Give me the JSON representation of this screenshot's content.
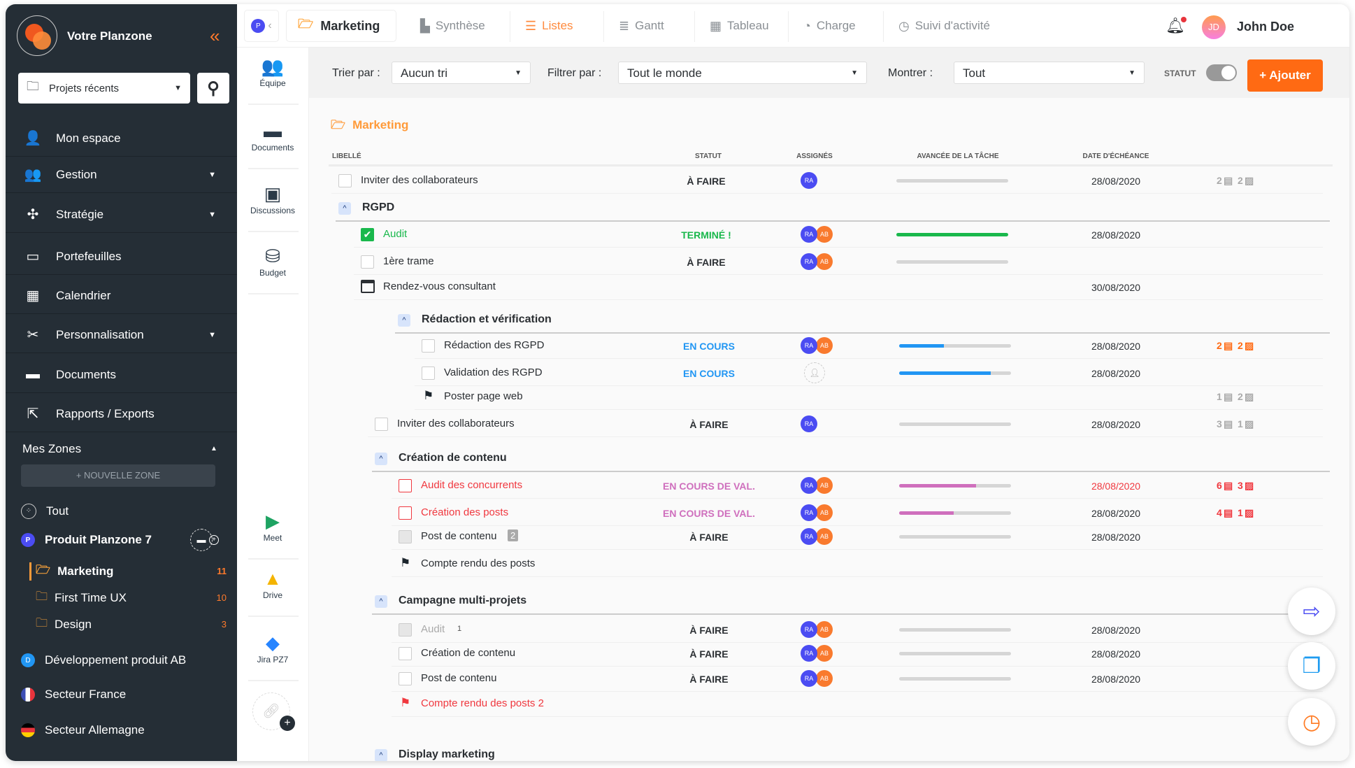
{
  "colors": {
    "accent": "#ff6a13",
    "sidebar": "#252e36",
    "ra": "#4b4cf2",
    "ab": "#f97a2e",
    "done": "#19b84c",
    "in_progress": "#2196f3",
    "validation": "#cf6fbd",
    "late": "#f0383f",
    "todo": "#2b2f33"
  },
  "sidebar": {
    "brand": "Votre Planzone",
    "recent_projects": "Projets récents",
    "menu": [
      {
        "label": "Mon espace",
        "icon": "user-lock-icon",
        "has_caret": false
      },
      {
        "label": "Gestion",
        "icon": "users-gear-icon",
        "has_caret": true
      },
      {
        "label": "Stratégie",
        "icon": "strategy-icon",
        "has_caret": true
      },
      {
        "label": "Portefeuilles",
        "icon": "wallet-icon",
        "has_caret": false
      },
      {
        "label": "Calendrier",
        "icon": "calendar-icon",
        "has_caret": false
      },
      {
        "label": "Personnalisation",
        "icon": "tools-icon",
        "has_caret": true
      },
      {
        "label": "Documents",
        "icon": "laptop-icon",
        "has_caret": false
      },
      {
        "label": "Rapports / Exports",
        "icon": "export-icon",
        "has_caret": false
      }
    ],
    "zones_title": "Mes Zones",
    "new_zone": "+ NOUVELLE ZONE",
    "all": "Tout",
    "project": {
      "badge": "P",
      "label": "Produit Planzone 7"
    },
    "folders": [
      {
        "label": "Marketing",
        "count": "11",
        "active": true
      },
      {
        "label": "First Time UX",
        "count": "10"
      },
      {
        "label": "Design",
        "count": "3"
      }
    ],
    "other_zones": [
      {
        "badge": "D",
        "label": "Développement produit AB"
      },
      {
        "label": "Secteur France",
        "icon": "flag-france-icon"
      },
      {
        "label": "Secteur Allemagne",
        "icon": "flag-germany-icon"
      }
    ]
  },
  "tools": [
    {
      "label": "Équipe",
      "icon": "team-icon"
    },
    {
      "label": "Documents",
      "icon": "laptop-icon"
    },
    {
      "label": "Discussions",
      "icon": "chat-icon"
    },
    {
      "label": "Budget",
      "icon": "coins-icon"
    },
    {
      "label": "Meet",
      "icon": "google-meet-icon"
    },
    {
      "label": "Drive",
      "icon": "google-drive-icon"
    },
    {
      "label": "Jira PZ7",
      "icon": "jira-icon"
    }
  ],
  "topbar": {
    "project_badge": "P",
    "current": "Marketing",
    "tabs": [
      {
        "label": "Synthèse",
        "icon": "dashboard-icon"
      },
      {
        "label": "Listes",
        "icon": "list-icon",
        "active": true
      },
      {
        "label": "Gantt",
        "icon": "gantt-icon"
      },
      {
        "label": "Tableau",
        "icon": "board-icon"
      },
      {
        "label": "Charge",
        "icon": "gauge-icon"
      },
      {
        "label": "Suivi d'activité",
        "icon": "clock-icon"
      }
    ],
    "user_initials": "JD",
    "user_name": "John Doe"
  },
  "filters": {
    "sort_label": "Trier par :",
    "sort_value": "Aucun tri",
    "filter_label": "Filtrer par :",
    "filter_value": "Tout le monde",
    "show_label": "Montrer :",
    "show_value": "Tout",
    "status_label": "STATUT",
    "status_toggle": false,
    "add_label": "+ Ajouter"
  },
  "list": {
    "title": "Marketing",
    "columns": [
      "LIBELLÉ",
      "STATUT",
      "ASSIGNÉS",
      "AVANCÉE DE LA TÂCHE",
      "DATE D'ÉCHÉANCE"
    ],
    "rows": [
      {
        "type": "task",
        "label": "Inviter des collaborateurs",
        "status": "À FAIRE",
        "tone": "todo",
        "assignees": [
          "RA"
        ],
        "progress": 0,
        "date": "28/08/2020",
        "comments": "2",
        "files": "2",
        "count_tone": "muted"
      },
      {
        "type": "group",
        "label": "RGPD"
      },
      {
        "type": "task",
        "label": "Audit",
        "status": "TERMINÉ !",
        "tone": "done",
        "checked": true,
        "assignees": [
          "RA",
          "AB"
        ],
        "progress": 100,
        "date": "28/08/2020"
      },
      {
        "type": "task",
        "label": "1ère trame",
        "status": "À FAIRE",
        "tone": "todo",
        "assignees": [
          "RA",
          "AB"
        ],
        "progress": 0
      },
      {
        "type": "event",
        "label": "Rendez-vous consultant",
        "date": "30/08/2020"
      },
      {
        "type": "group",
        "label": "Rédaction et vérification"
      },
      {
        "type": "task",
        "label": "Rédaction des RGPD",
        "status": "EN COURS",
        "tone": "in_progress",
        "assignees": [
          "RA",
          "AB"
        ],
        "progress": 40,
        "date": "28/08/2020",
        "comments": "2",
        "files": "2",
        "count_tone": "accent"
      },
      {
        "type": "task",
        "label": "Validation des RGPD",
        "status": "EN COURS",
        "tone": "in_progress",
        "assignees": [],
        "progress": 82,
        "date": "28/08/2020"
      },
      {
        "type": "milestone",
        "label": "Poster page web",
        "comments": "1",
        "files": "2",
        "count_tone": "muted"
      },
      {
        "type": "task",
        "label": "Inviter des collaborateurs",
        "status": "À FAIRE",
        "tone": "todo",
        "assignees": [
          "RA"
        ],
        "progress": 0,
        "date": "28/08/2020",
        "comments": "3",
        "files": "1",
        "count_tone": "muted"
      },
      {
        "type": "group",
        "label": "Création de contenu"
      },
      {
        "type": "task",
        "label": "Audit des concurrents",
        "status": "EN COURS DE VAL.",
        "tone": "validation",
        "late": true,
        "late_date": true,
        "assignees": [
          "RA",
          "AB"
        ],
        "progress": 69,
        "date": "28/08/2020",
        "comments": "6",
        "files": "3",
        "count_tone": "late"
      },
      {
        "type": "task",
        "label": "Création des posts",
        "status": "EN COURS DE VAL.",
        "tone": "validation",
        "late": true,
        "assignees": [
          "RA",
          "AB"
        ],
        "progress": 49,
        "date": "28/08/2020",
        "comments": "4",
        "files": "1",
        "count_tone": "late"
      },
      {
        "type": "task",
        "label": "Post de contenu",
        "badge": "2",
        "status": "À FAIRE",
        "tone": "todo",
        "disabled": true,
        "assignees": [
          "RA",
          "AB"
        ],
        "progress": 0,
        "date": "28/08/2020"
      },
      {
        "type": "milestone",
        "label": "Compte rendu des posts"
      },
      {
        "type": "group",
        "label": "Campagne multi-projets"
      },
      {
        "type": "task",
        "label": "Audit",
        "sub": "1",
        "status": "À FAIRE",
        "tone": "todo",
        "disabled": true,
        "faded": true,
        "assignees": [
          "RA",
          "AB"
        ],
        "progress": 0,
        "date": "28/08/2020"
      },
      {
        "type": "task",
        "label": "Création de contenu",
        "status": "À FAIRE",
        "tone": "todo",
        "assignees": [
          "RA",
          "AB"
        ],
        "progress": 0,
        "date": "28/08/2020"
      },
      {
        "type": "task",
        "label": "Post de contenu",
        "status": "À FAIRE",
        "tone": "todo",
        "assignees": [
          "RA",
          "AB"
        ],
        "progress": 0,
        "date": "28/08/2020"
      },
      {
        "type": "milestone",
        "label": "Compte rendu des posts 2",
        "late": true
      },
      {
        "type": "group",
        "label": "Display marketing"
      }
    ]
  },
  "fabs": [
    {
      "icon": "export-file-icon"
    },
    {
      "icon": "copy-windows-icon"
    },
    {
      "icon": "timer-icon"
    }
  ]
}
